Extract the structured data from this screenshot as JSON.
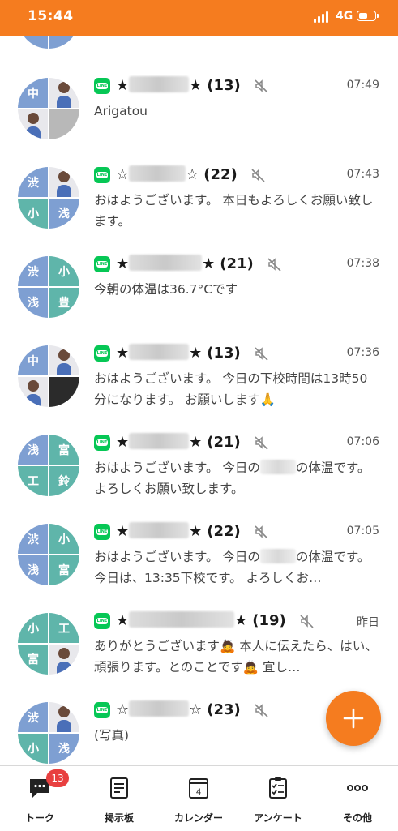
{
  "status_bar": {
    "time": "15:44",
    "network": "4G"
  },
  "chats": [
    {
      "avatar": [
        "中",
        "photo",
        "photo",
        "blur-photo"
      ],
      "star_left": "★",
      "star_right": "★",
      "count": "(13)",
      "time": "07:49",
      "preview": "Arigatou"
    },
    {
      "avatar": [
        "渋",
        "photo",
        "小",
        "浅"
      ],
      "star_left": "☆",
      "star_right": "☆",
      "count": "(22)",
      "time": "07:43",
      "preview": "おはようございます。 本日もよろしくお願い致します。"
    },
    {
      "avatar": [
        "渋",
        "小",
        "浅",
        "豊"
      ],
      "star_left": "★",
      "star_right": "★",
      "count": "(21)",
      "time": "07:38",
      "preview": "今朝の体温は36.7°Cです"
    },
    {
      "avatar": [
        "中",
        "photo",
        "photo",
        "dark-photo"
      ],
      "star_left": "★",
      "star_right": "★",
      "count": "(13)",
      "time": "07:36",
      "preview": "おはようございます。 今日の下校時間は13時50分になります。 お願いします🙏"
    },
    {
      "avatar": [
        "浅",
        "富",
        "工",
        "鈴"
      ],
      "star_left": "★",
      "star_right": "★",
      "count": "(21)",
      "time": "07:06",
      "preview_before": "おはようございます。 今日の",
      "preview_after": "の体温です。 よろしくお願い致します。"
    },
    {
      "avatar": [
        "渋",
        "小",
        "浅",
        "富"
      ],
      "star_left": "★",
      "star_right": "★",
      "count": "(22)",
      "time": "07:05",
      "preview_before": "おはようございます。 今日の",
      "preview_after": "の体温です。 今日は、13:35下校です。 よろしくお…"
    },
    {
      "avatar": [
        "小",
        "工",
        "富",
        "photo"
      ],
      "star_left": "★",
      "star_right": "★",
      "count": "(19)",
      "time": "昨日",
      "preview": "ありがとうございます🙇 本人に伝えたら、はい、頑張ります。とのことです🙇 宜し…"
    },
    {
      "avatar": [
        "渋",
        "photo",
        "小",
        "浅"
      ],
      "star_left": "☆",
      "star_right": "☆",
      "count": "(23)",
      "time": "",
      "preview": "(写真)"
    }
  ],
  "tabs": [
    {
      "label": "トーク",
      "icon": "chat-icon",
      "badge": "13"
    },
    {
      "label": "掲示板",
      "icon": "board-icon"
    },
    {
      "label": "カレンダー",
      "icon": "calendar-icon",
      "calendar_day": "4"
    },
    {
      "label": "アンケート",
      "icon": "survey-icon"
    },
    {
      "label": "その他",
      "icon": "more-icon"
    }
  ],
  "colors": {
    "accent": "#f57c1f",
    "line_green": "#06c755",
    "badge_red": "#e84040"
  }
}
